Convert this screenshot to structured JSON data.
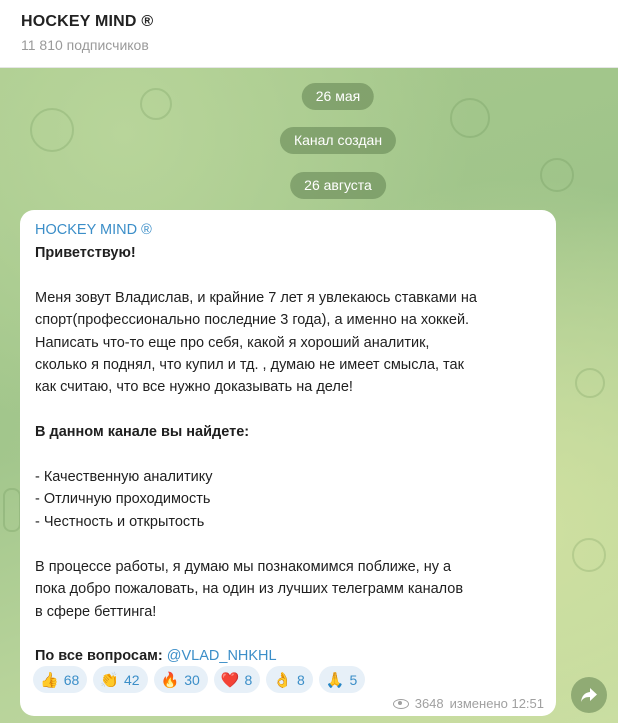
{
  "header": {
    "title": "HOCKEY MIND ®",
    "subscribers": "11 810 подписчиков"
  },
  "date_pills": [
    "26 мая",
    "Канал создан",
    "26 августа"
  ],
  "post": {
    "sender": "HOCKEY MIND ®",
    "greeting": "Приветствую!",
    "paragraph1": [
      "Меня зовут Владислав, и крайние 7 лет я увлекаюсь ставками на",
      "спорт(профессионально последние 3 года), а именно на хоккей.",
      "Написать что-то еще про себя, какой я хороший аналитик,",
      "сколько я поднял, что купил и тд. , думаю не имеет смысла, так",
      "как считаю, что все нужно доказывать на деле!"
    ],
    "section_title": "В данном канале вы найдете:",
    "list": [
      "- Качественную аналитику",
      "- Отличную проходимость",
      "- Честность и открытость"
    ],
    "paragraph2": [
      "В процессе работы, я думаю мы познакомимся поближе, ну а",
      "пока добро пожаловать, на один из лучших телеграмм каналов",
      "в сфере беттинга!"
    ],
    "contact_label": "По все вопросам:",
    "contact_mention": "@VLAD_NHKHL",
    "reactions": [
      {
        "emoji": "👍",
        "count": "68"
      },
      {
        "emoji": "👏",
        "count": "42"
      },
      {
        "emoji": "🔥",
        "count": "30"
      },
      {
        "emoji": "❤️",
        "count": "8"
      },
      {
        "emoji": "👌",
        "count": "8"
      },
      {
        "emoji": "🙏",
        "count": "5"
      }
    ],
    "views": "3648",
    "edited_time": "изменено 12:51"
  },
  "colors": {
    "accent": "#3b8ec8",
    "pill_bg": "#7a9c66"
  }
}
